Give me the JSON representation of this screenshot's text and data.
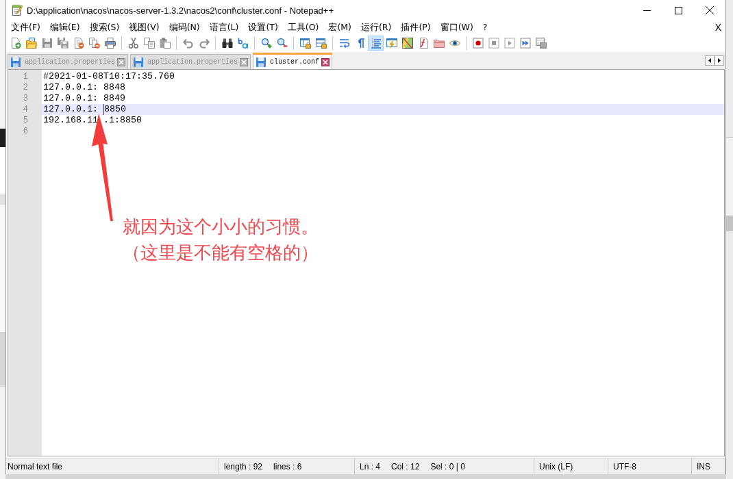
{
  "window": {
    "title": "D:\\application\\nacos\\nacos-server-1.3.2\\nacos2\\conf\\cluster.conf - Notepad++"
  },
  "menu": {
    "items": [
      "文件(F)",
      "编辑(E)",
      "搜索(S)",
      "视图(V)",
      "编码(N)",
      "语言(L)",
      "设置(T)",
      "工具(O)",
      "宏(M)",
      "运行(R)",
      "插件(P)",
      "窗口(W)",
      "?"
    ],
    "close_document": "X"
  },
  "toolbar": {
    "groups": [
      [
        {
          "kind": "new",
          "pressed": false,
          "disabled": false
        },
        {
          "kind": "open",
          "pressed": false,
          "disabled": false
        },
        {
          "kind": "save",
          "pressed": false,
          "disabled": true
        },
        {
          "kind": "saveall",
          "pressed": false,
          "disabled": true
        },
        {
          "kind": "close",
          "pressed": false,
          "disabled": false
        },
        {
          "kind": "closeall",
          "pressed": false,
          "disabled": false
        },
        {
          "kind": "print",
          "pressed": false,
          "disabled": false
        }
      ],
      [
        {
          "kind": "cut",
          "pressed": false,
          "disabled": true
        },
        {
          "kind": "copy",
          "pressed": false,
          "disabled": true
        },
        {
          "kind": "paste",
          "pressed": false,
          "disabled": true
        }
      ],
      [
        {
          "kind": "undo",
          "pressed": false,
          "disabled": true
        },
        {
          "kind": "redo",
          "pressed": false,
          "disabled": true
        }
      ],
      [
        {
          "kind": "find",
          "pressed": false,
          "disabled": false
        },
        {
          "kind": "replace",
          "pressed": false,
          "disabled": false
        }
      ],
      [
        {
          "kind": "zoomin",
          "pressed": false,
          "disabled": false
        },
        {
          "kind": "zoomout",
          "pressed": false,
          "disabled": false
        }
      ],
      [
        {
          "kind": "syncv",
          "pressed": false,
          "disabled": false
        },
        {
          "kind": "synch",
          "pressed": false,
          "disabled": false
        }
      ],
      [
        {
          "kind": "wrap",
          "pressed": false,
          "disabled": false
        },
        {
          "kind": "allchars",
          "pressed": false,
          "disabled": false
        },
        {
          "kind": "indent",
          "pressed": true,
          "disabled": false
        },
        {
          "kind": "udl",
          "pressed": false,
          "disabled": false
        },
        {
          "kind": "docmap",
          "pressed": false,
          "disabled": false
        },
        {
          "kind": "funclist",
          "pressed": false,
          "disabled": false
        },
        {
          "kind": "workspace",
          "pressed": false,
          "disabled": false
        },
        {
          "kind": "monitor",
          "pressed": false,
          "disabled": false
        }
      ],
      [
        {
          "kind": "record",
          "pressed": false,
          "disabled": false
        },
        {
          "kind": "stop",
          "pressed": false,
          "disabled": true
        },
        {
          "kind": "play",
          "pressed": false,
          "disabled": true
        },
        {
          "kind": "playmulti",
          "pressed": false,
          "disabled": false
        },
        {
          "kind": "savemacro",
          "pressed": false,
          "disabled": true
        }
      ]
    ]
  },
  "tabs": [
    {
      "label": "application.properties",
      "selected": false
    },
    {
      "label": "application.properties",
      "selected": false
    },
    {
      "label": "cluster.conf",
      "selected": true
    }
  ],
  "editor": {
    "lines": [
      {
        "number": "1",
        "current": false,
        "pieces": [
          {
            "kind": "text",
            "text": "#2021-01-08T10:17:35.760"
          }
        ]
      },
      {
        "number": "2",
        "current": false,
        "pieces": [
          {
            "kind": "text",
            "text": "127.0.0.1: 8848"
          }
        ]
      },
      {
        "number": "3",
        "current": false,
        "pieces": [
          {
            "kind": "text",
            "text": "127.0.0.1: 8849"
          }
        ]
      },
      {
        "number": "4",
        "current": true,
        "pieces": [
          {
            "kind": "text",
            "text": "127.0.0.1: "
          },
          {
            "kind": "caret"
          },
          {
            "kind": "text",
            "text": "8850"
          }
        ]
      },
      {
        "number": "5",
        "current": false,
        "pieces": [
          {
            "kind": "text",
            "text": "192.168.11"
          },
          {
            "kind": "covered"
          },
          {
            "kind": "text",
            "text": ".1:8850"
          }
        ]
      },
      {
        "number": "6",
        "current": false
      }
    ]
  },
  "annotation": {
    "lines": [
      "就因为这个小小的习惯。",
      "（这里是不能有空格的）"
    ]
  },
  "status_bar": {
    "sections": [
      [
        "Normal text file"
      ],
      [
        "length : 92",
        "lines : 6"
      ],
      [
        "Ln : 4",
        "Col : 12",
        "Sel : 0 | 0"
      ],
      [
        "Unix (LF)"
      ],
      [
        "UTF-8"
      ],
      [
        "INS"
      ]
    ]
  }
}
